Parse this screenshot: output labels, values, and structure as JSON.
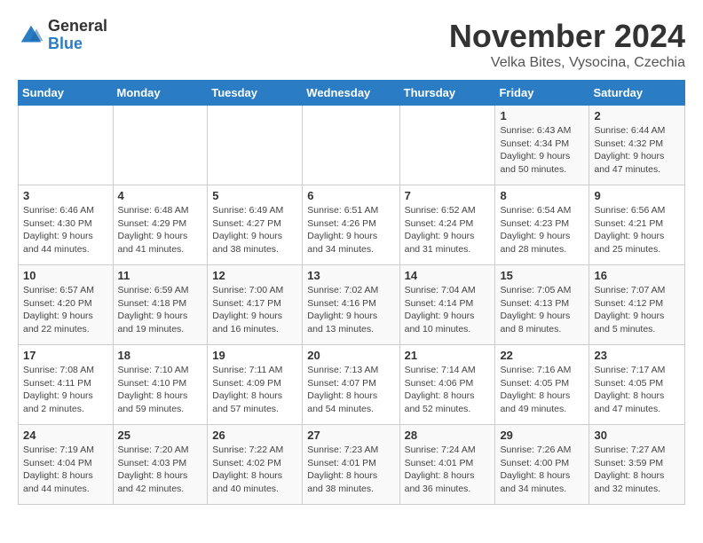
{
  "header": {
    "logo_general": "General",
    "logo_blue": "Blue",
    "month_title": "November 2024",
    "location": "Velka Bites, Vysocina, Czechia"
  },
  "calendar": {
    "headers": [
      "Sunday",
      "Monday",
      "Tuesday",
      "Wednesday",
      "Thursday",
      "Friday",
      "Saturday"
    ],
    "weeks": [
      [
        {
          "day": "",
          "info": ""
        },
        {
          "day": "",
          "info": ""
        },
        {
          "day": "",
          "info": ""
        },
        {
          "day": "",
          "info": ""
        },
        {
          "day": "",
          "info": ""
        },
        {
          "day": "1",
          "info": "Sunrise: 6:43 AM\nSunset: 4:34 PM\nDaylight: 9 hours and 50 minutes."
        },
        {
          "day": "2",
          "info": "Sunrise: 6:44 AM\nSunset: 4:32 PM\nDaylight: 9 hours and 47 minutes."
        }
      ],
      [
        {
          "day": "3",
          "info": "Sunrise: 6:46 AM\nSunset: 4:30 PM\nDaylight: 9 hours and 44 minutes."
        },
        {
          "day": "4",
          "info": "Sunrise: 6:48 AM\nSunset: 4:29 PM\nDaylight: 9 hours and 41 minutes."
        },
        {
          "day": "5",
          "info": "Sunrise: 6:49 AM\nSunset: 4:27 PM\nDaylight: 9 hours and 38 minutes."
        },
        {
          "day": "6",
          "info": "Sunrise: 6:51 AM\nSunset: 4:26 PM\nDaylight: 9 hours and 34 minutes."
        },
        {
          "day": "7",
          "info": "Sunrise: 6:52 AM\nSunset: 4:24 PM\nDaylight: 9 hours and 31 minutes."
        },
        {
          "day": "8",
          "info": "Sunrise: 6:54 AM\nSunset: 4:23 PM\nDaylight: 9 hours and 28 minutes."
        },
        {
          "day": "9",
          "info": "Sunrise: 6:56 AM\nSunset: 4:21 PM\nDaylight: 9 hours and 25 minutes."
        }
      ],
      [
        {
          "day": "10",
          "info": "Sunrise: 6:57 AM\nSunset: 4:20 PM\nDaylight: 9 hours and 22 minutes."
        },
        {
          "day": "11",
          "info": "Sunrise: 6:59 AM\nSunset: 4:18 PM\nDaylight: 9 hours and 19 minutes."
        },
        {
          "day": "12",
          "info": "Sunrise: 7:00 AM\nSunset: 4:17 PM\nDaylight: 9 hours and 16 minutes."
        },
        {
          "day": "13",
          "info": "Sunrise: 7:02 AM\nSunset: 4:16 PM\nDaylight: 9 hours and 13 minutes."
        },
        {
          "day": "14",
          "info": "Sunrise: 7:04 AM\nSunset: 4:14 PM\nDaylight: 9 hours and 10 minutes."
        },
        {
          "day": "15",
          "info": "Sunrise: 7:05 AM\nSunset: 4:13 PM\nDaylight: 9 hours and 8 minutes."
        },
        {
          "day": "16",
          "info": "Sunrise: 7:07 AM\nSunset: 4:12 PM\nDaylight: 9 hours and 5 minutes."
        }
      ],
      [
        {
          "day": "17",
          "info": "Sunrise: 7:08 AM\nSunset: 4:11 PM\nDaylight: 9 hours and 2 minutes."
        },
        {
          "day": "18",
          "info": "Sunrise: 7:10 AM\nSunset: 4:10 PM\nDaylight: 8 hours and 59 minutes."
        },
        {
          "day": "19",
          "info": "Sunrise: 7:11 AM\nSunset: 4:09 PM\nDaylight: 8 hours and 57 minutes."
        },
        {
          "day": "20",
          "info": "Sunrise: 7:13 AM\nSunset: 4:07 PM\nDaylight: 8 hours and 54 minutes."
        },
        {
          "day": "21",
          "info": "Sunrise: 7:14 AM\nSunset: 4:06 PM\nDaylight: 8 hours and 52 minutes."
        },
        {
          "day": "22",
          "info": "Sunrise: 7:16 AM\nSunset: 4:05 PM\nDaylight: 8 hours and 49 minutes."
        },
        {
          "day": "23",
          "info": "Sunrise: 7:17 AM\nSunset: 4:05 PM\nDaylight: 8 hours and 47 minutes."
        }
      ],
      [
        {
          "day": "24",
          "info": "Sunrise: 7:19 AM\nSunset: 4:04 PM\nDaylight: 8 hours and 44 minutes."
        },
        {
          "day": "25",
          "info": "Sunrise: 7:20 AM\nSunset: 4:03 PM\nDaylight: 8 hours and 42 minutes."
        },
        {
          "day": "26",
          "info": "Sunrise: 7:22 AM\nSunset: 4:02 PM\nDaylight: 8 hours and 40 minutes."
        },
        {
          "day": "27",
          "info": "Sunrise: 7:23 AM\nSunset: 4:01 PM\nDaylight: 8 hours and 38 minutes."
        },
        {
          "day": "28",
          "info": "Sunrise: 7:24 AM\nSunset: 4:01 PM\nDaylight: 8 hours and 36 minutes."
        },
        {
          "day": "29",
          "info": "Sunrise: 7:26 AM\nSunset: 4:00 PM\nDaylight: 8 hours and 34 minutes."
        },
        {
          "day": "30",
          "info": "Sunrise: 7:27 AM\nSunset: 3:59 PM\nDaylight: 8 hours and 32 minutes."
        }
      ]
    ]
  }
}
